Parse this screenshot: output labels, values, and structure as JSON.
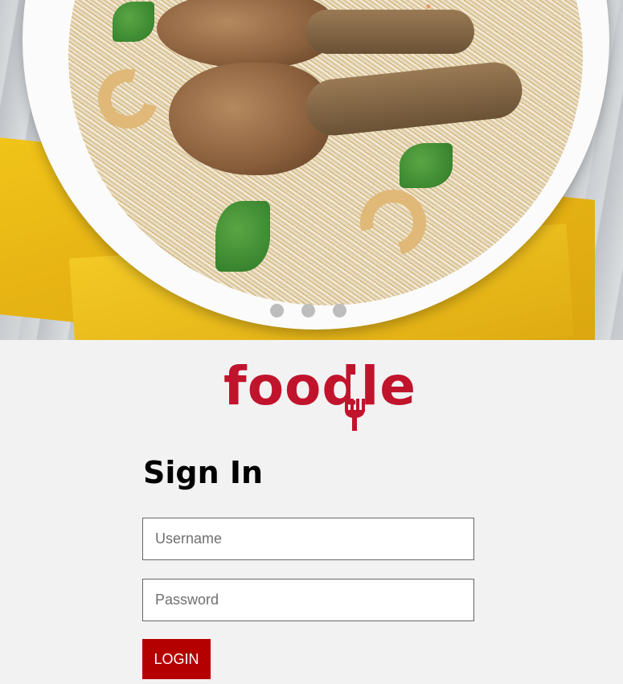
{
  "carousel": {
    "slide_count": 3,
    "image_alt": "Chicken biryani in a white bowl"
  },
  "brand": {
    "logo_text": "foodle",
    "color": "#c0142c"
  },
  "form": {
    "title": "Sign In",
    "username_placeholder": "Username",
    "password_placeholder": "Password",
    "login_label": "LOGIN",
    "login_color": "#b50000"
  }
}
